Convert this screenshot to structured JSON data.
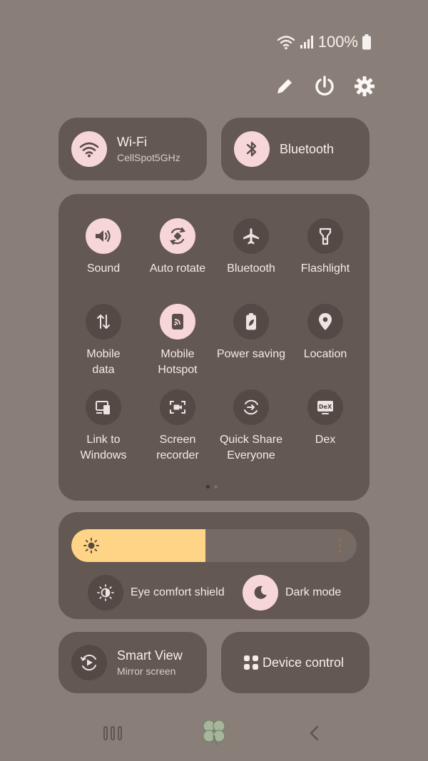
{
  "status": {
    "battery_text": "100%"
  },
  "top_actions": {
    "edit": "pencil-icon",
    "power": "power-icon",
    "settings": "gear-icon"
  },
  "tiles": {
    "wifi": {
      "title": "Wi-Fi",
      "subtitle": "CellSpot5GHz",
      "state": "on"
    },
    "bluetooth": {
      "title": "Bluetooth",
      "state": "on"
    },
    "smart_view": {
      "title": "Smart View",
      "subtitle": "Mirror screen"
    },
    "device_control": {
      "title": "Device control"
    }
  },
  "quick_settings": [
    {
      "label": "Sound",
      "state": "on",
      "icon": "speaker-icon"
    },
    {
      "label": "Auto rotate",
      "state": "on",
      "icon": "rotate-icon"
    },
    {
      "label": "Bluetooth",
      "state": "off",
      "icon": "airplane-icon"
    },
    {
      "label": "Flashlight",
      "state": "off",
      "icon": "flashlight-icon"
    },
    {
      "label": "Mobile\ndata",
      "state": "off",
      "icon": "data-arrows-icon"
    },
    {
      "label": "Mobile\nHotspot",
      "state": "on",
      "icon": "hotspot-icon"
    },
    {
      "label": "Power saving",
      "state": "off",
      "icon": "battery-leaf-icon"
    },
    {
      "label": "Location",
      "state": "off",
      "icon": "location-pin-icon"
    },
    {
      "label": "Link to\nWindows",
      "state": "off",
      "icon": "link-windows-icon"
    },
    {
      "label": "Screen\nrecorder",
      "state": "off",
      "icon": "screen-recorder-icon"
    },
    {
      "label": "Quick Share\nEveryone",
      "state": "off",
      "icon": "quick-share-icon"
    },
    {
      "label": "Dex",
      "state": "off",
      "icon": "dex-icon"
    }
  ],
  "pager": {
    "page_count": 2,
    "current": 1
  },
  "brightness": {
    "level": 0.47
  },
  "display_options": {
    "eye_comfort": "Eye comfort shield",
    "dark_mode": "Dark mode"
  },
  "colors": {
    "accent": "#f7d6d9",
    "brightness": "#ffd486",
    "panel": "#645852",
    "background": "#8a7f78"
  }
}
